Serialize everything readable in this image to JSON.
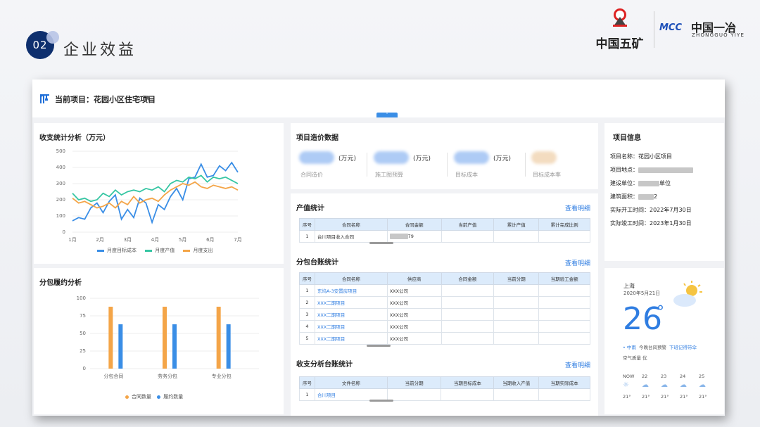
{
  "section": {
    "number": "02",
    "title": "企业效益"
  },
  "logos": {
    "left_text": "中国五矿",
    "mcc": "MCC",
    "cn": "中国一冶",
    "en": "ZHONGGUO YIYE"
  },
  "topbar": {
    "current_project": "当前项目：花园小区住宅项目"
  },
  "income_chart": {
    "title": "收支统计分析（万元）",
    "chart_data": {
      "type": "line",
      "title": "收支统计分析（万元）",
      "x": [
        "1月",
        "2月",
        "3月",
        "4月",
        "5月",
        "6月",
        "7月"
      ],
      "ylim": [
        0,
        500
      ],
      "yticks": [
        0,
        100,
        200,
        300,
        400,
        500
      ],
      "grid": true,
      "legend": "bottom",
      "series": [
        {
          "name": "月度目标成本",
          "color": "#3a8ee6",
          "values": [
            70,
            90,
            80,
            150,
            180,
            120,
            190,
            230,
            80,
            140,
            90,
            210,
            180,
            60,
            170,
            140,
            220,
            270,
            200,
            330,
            340,
            420,
            340,
            350,
            410,
            380,
            430,
            370
          ]
        },
        {
          "name": "月度产值",
          "color": "#36c6a3",
          "values": [
            240,
            200,
            210,
            190,
            200,
            240,
            220,
            260,
            230,
            250,
            260,
            250,
            270,
            260,
            280,
            250,
            300,
            320,
            310,
            340,
            330,
            350,
            310,
            340,
            330,
            340,
            320,
            300
          ]
        },
        {
          "name": "月度支出",
          "color": "#f4a548",
          "values": [
            210,
            180,
            190,
            170,
            150,
            160,
            180,
            150,
            190,
            170,
            220,
            180,
            200,
            210,
            190,
            230,
            260,
            280,
            300,
            290,
            310,
            280,
            270,
            290,
            280,
            270,
            280,
            260
          ]
        }
      ]
    }
  },
  "contract_chart": {
    "title": "分包履约分析",
    "chart_data": {
      "type": "bar",
      "title": "分包履约分析",
      "categories": [
        "分包合同",
        "劳务分包",
        "专业分包"
      ],
      "ylim": [
        0,
        100
      ],
      "yticks": [
        0,
        25,
        50,
        75,
        100
      ],
      "legend": "bottom",
      "series": [
        {
          "name": "合同数量",
          "color": "#f4a548",
          "values": [
            88,
            88,
            88
          ]
        },
        {
          "name": "履约数量",
          "color": "#3a8ee6",
          "values": [
            63,
            63,
            63
          ]
        }
      ]
    }
  },
  "cost_data": {
    "title": "项目造价数据",
    "items": [
      {
        "unit": "(万元)",
        "label": "合同造价"
      },
      {
        "unit": "(万元)",
        "label": "施工图预算"
      },
      {
        "unit": "(万元)",
        "label": "目标成本"
      },
      {
        "unit": "",
        "label": "目标成本率"
      }
    ]
  },
  "output_stats": {
    "title": "产值统计",
    "link": "查看明细",
    "headers": [
      "序号",
      "合同名称",
      "合同金额",
      "当前产值",
      "累计产值",
      "累计完成比例"
    ],
    "rows": [
      [
        "1",
        "台川项目收入合同",
        "79",
        "",
        "",
        ""
      ]
    ]
  },
  "sub_ledger": {
    "title": "分包台账统计",
    "link": "查看明细",
    "headers": [
      "序号",
      "合同名称",
      "供应商",
      "合同金额",
      "当前分期",
      "当期验工金额"
    ],
    "rows": [
      [
        "1",
        "东坞A-3安置房项目",
        "XXX公司"
      ],
      [
        "2",
        "XXX二期项目",
        "XXX公司"
      ],
      [
        "3",
        "XXX二期项目",
        "XXX公司"
      ],
      [
        "4",
        "XXX二期项目",
        "XXX公司"
      ],
      [
        "5",
        "XXX二期项目",
        "XXX公司"
      ]
    ]
  },
  "inout_ledger": {
    "title": "收支分析台账统计",
    "link": "查看明细",
    "headers": [
      "序号",
      "文件名称",
      "当前分期",
      "当期目标成本",
      "当期收入产值",
      "当期实际成本"
    ],
    "rows": [
      [
        "1",
        "合川项目"
      ]
    ]
  },
  "project_info": {
    "title": "项目信息",
    "name": "项目名称：花园小区项目",
    "location": "项目地点：",
    "builder": "建设单位：",
    "builder_suffix": "单位",
    "area": "建筑面积：",
    "area_suffix": "2",
    "start": "实际开工时间：2022年7月30日",
    "end": "实际竣工时间：2023年1月30日"
  },
  "weather": {
    "city": "上海",
    "date": "2020年5月21日",
    "temp": "26",
    "deg": "°",
    "cond": "中雨",
    "warn": "今晚台风预警",
    "link": "下班记得带伞",
    "air": "空气质量  优",
    "forecast": [
      {
        "day": "NOW",
        "t": "21°"
      },
      {
        "day": "22",
        "t": "21°"
      },
      {
        "day": "23",
        "t": "21°"
      },
      {
        "day": "24",
        "t": "21°"
      },
      {
        "day": "25",
        "t": "21°"
      }
    ]
  }
}
